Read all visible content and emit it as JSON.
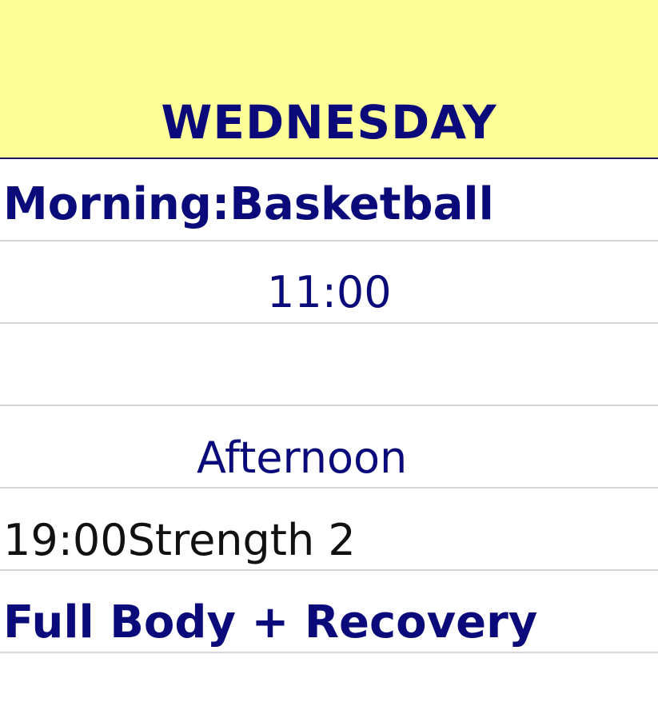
{
  "header": {
    "day": "WEDNESDAY"
  },
  "rows": [
    {
      "text": "Morning:Basketball"
    },
    {
      "text": "11:00"
    },
    {
      "text": ""
    },
    {
      "text": "Afternoon"
    },
    {
      "text": "19:00Strength 2"
    },
    {
      "text": "Full Body + Recovery"
    }
  ],
  "colors": {
    "header_background": "#ffff99",
    "text_navy": "#0a0a7a",
    "text_black": "#111111",
    "grid_line": "#d6d6d6"
  }
}
